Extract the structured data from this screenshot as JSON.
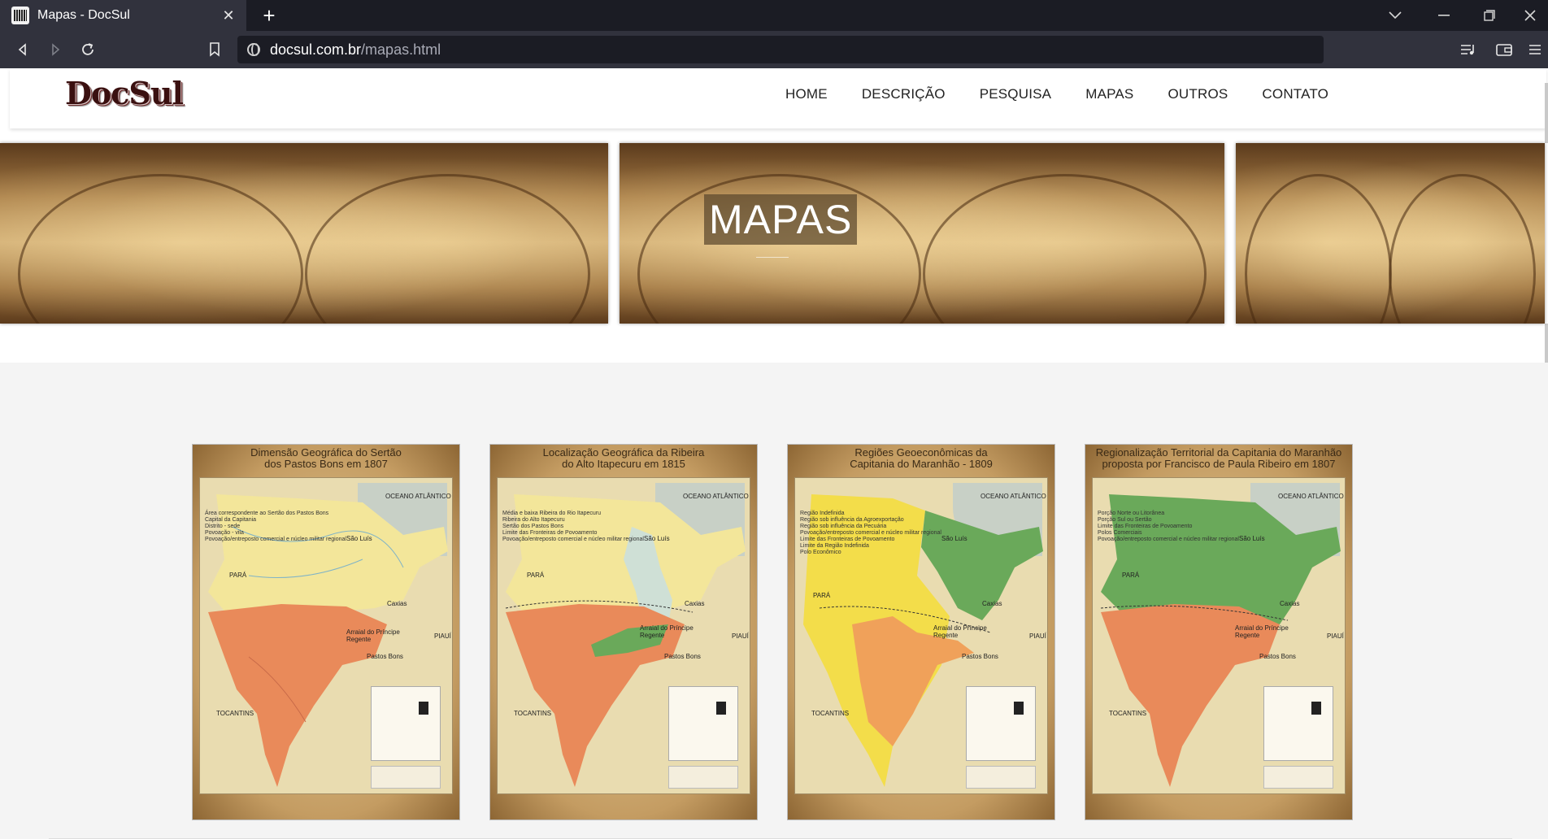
{
  "browser": {
    "tab_title": "Mapas - DocSul",
    "tab_close": "✕",
    "new_tab": "+",
    "url_host": "docsul.com.br",
    "url_path": "/mapas.html",
    "icons": [
      "back-icon",
      "forward-icon",
      "reload-icon",
      "bookmark-icon",
      "globe-icon",
      "playlist-icon",
      "wallet-icon",
      "menu-icon",
      "chevron-down-icon",
      "minimize-icon",
      "restore-icon",
      "close-icon"
    ]
  },
  "site": {
    "logo": "DocSul",
    "nav": [
      "HOME",
      "DESCRIÇÃO",
      "PESQUISA",
      "MAPAS",
      "OUTROS",
      "CONTATO"
    ]
  },
  "banner": {
    "title": "MAPAS"
  },
  "maps": [
    {
      "title_line1": "Dimensão Geográfica do Sertão",
      "title_line2": "dos Pastos Bons em 1807",
      "legend": [
        "Área correspondente ao Sertão dos Pastos Bons",
        "Capital da Capitania",
        "Distrito - sede",
        "Povoação - vila",
        "Povoação/entreposto comercial e núcleo militar regional"
      ],
      "cities": [
        "São Luís",
        "Caxias",
        "Arraial do Príncipe Regente",
        "Pastos Bons",
        "TOCANTINS",
        "PIAUÍ",
        "PARÁ",
        "OCEANO ATLÂNTICO"
      ]
    },
    {
      "title_line1": "Localização Geográfica da Ribeira",
      "title_line2": "do Alto Itapecuru em 1815",
      "legend": [
        "Média e baixa Ribeira do Rio Itapecuru",
        "Ribeira do Alto Itapecuru",
        "Sertão dos Pastos Bons",
        "Limite das Fronteiras de Povoamento",
        "Povoação/entreposto comercial e núcleo militar regional"
      ],
      "cities": [
        "São Luís",
        "Caxias",
        "Arraial do Príncipe Regente",
        "Pastos Bons",
        "TOCANTINS",
        "PIAUÍ",
        "PARÁ",
        "OCEANO ATLÂNTICO"
      ]
    },
    {
      "title_line1": "Regiões Geoeconômicas da",
      "title_line2": "Capitania do Maranhão - 1809",
      "legend": [
        "Região Indefinida",
        "Região sob influência da Agroexportação",
        "Região sob influência da Pecuária",
        "Povoação/entreposto comercial e núcleo militar regional",
        "Limite das Fronteiras de Povoamento",
        "Limite da Região Indefinida",
        "Polo Econômico"
      ],
      "cities": [
        "São Luís",
        "Caxias",
        "Arraial do Príncipe Regente",
        "Pastos Bons",
        "TOCANTINS",
        "PIAUÍ",
        "PARÁ",
        "OCEANO ATLÂNTICO"
      ]
    },
    {
      "title_line1": "Regionalização Territorial da Capitania do Maranhão",
      "title_line2": "proposta por Francisco de Paula Ribeiro em 1807",
      "legend": [
        "Porção Norte ou Litorânea",
        "Porção Sul ou Sertão",
        "Limite das Fronteiras de Povoamento",
        "Polos Comerciais",
        "Povoação/entreposto comercial e núcleo militar regional"
      ],
      "cities": [
        "São Luís",
        "Caxias",
        "Arraial do Príncipe Regente",
        "Pastos Bons",
        "TOCANTINS",
        "PIAUÍ",
        "PARÁ",
        "OCEANO ATLÂNTICO"
      ]
    }
  ],
  "colors": {
    "orange_region": "#e98a5a",
    "yellow_region": "#f3e69a",
    "green_region": "#6aa95a",
    "light_blue_region": "#cfe0d6",
    "bright_yellow_region": "#f3dd4a"
  }
}
